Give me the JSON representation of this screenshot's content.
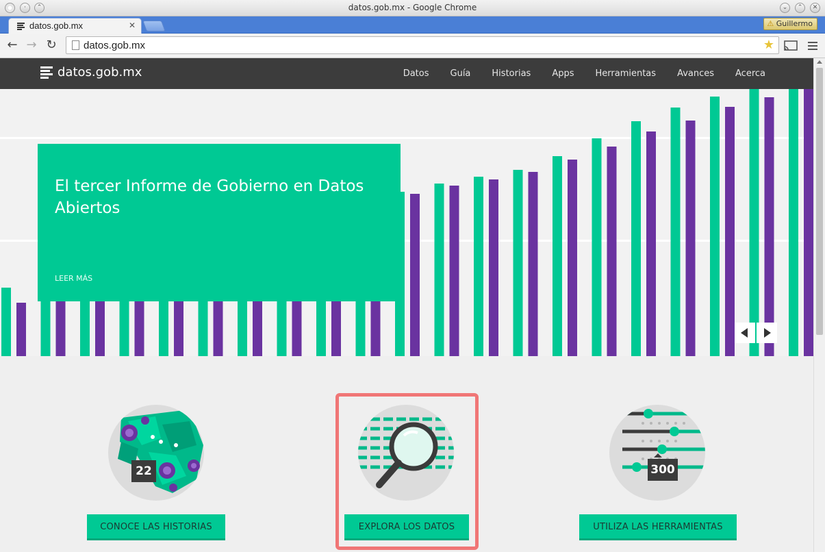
{
  "window": {
    "title": "datos.gob.mx - Google Chrome"
  },
  "tabs": [
    {
      "title": "datos.gob.mx"
    }
  ],
  "profile": {
    "name": "Guillermo"
  },
  "address": {
    "url": "datos.gob.mx"
  },
  "site": {
    "logo": "datos.gob.mx",
    "nav": [
      "Datos",
      "Guía",
      "Historias",
      "Apps",
      "Herramientas",
      "Avances",
      "Acerca"
    ]
  },
  "hero": {
    "title": "El tercer Informe de Gobierno en Datos Abiertos",
    "link": "LEER MÁS"
  },
  "features": [
    {
      "badge": "22",
      "button": "CONOCE LAS HISTORIAS"
    },
    {
      "button": "EXPLORA LOS DATOS"
    },
    {
      "badge": "300",
      "button": "UTILIZA LAS HERRAMIENTAS"
    }
  ],
  "colors": {
    "green": "#00c994",
    "purple": "#6a33a0",
    "nav": "#3c3c3c",
    "highlight": "#f07676"
  }
}
